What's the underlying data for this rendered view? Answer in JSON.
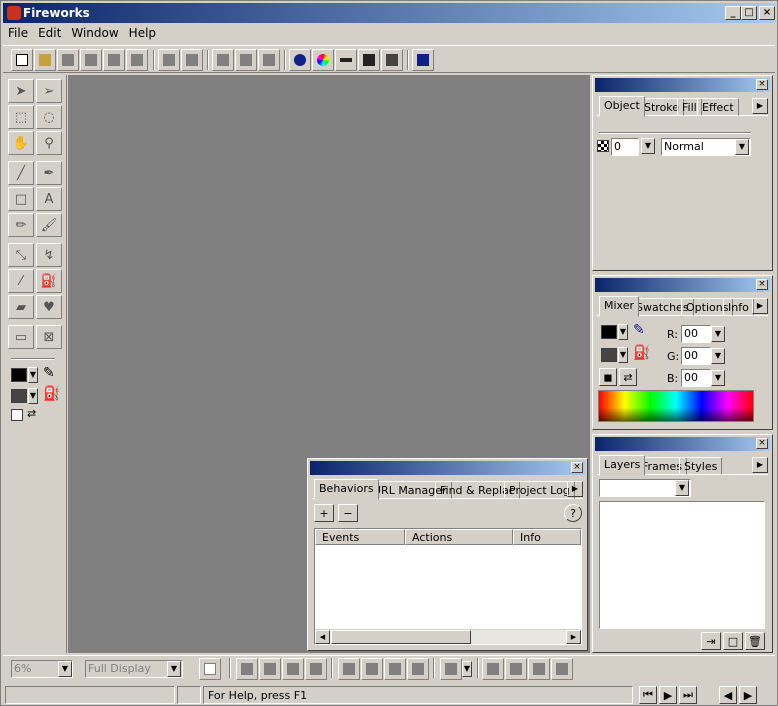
{
  "app": {
    "title": "Fireworks"
  },
  "window_controls": {
    "minimize": "_",
    "maximize": "□",
    "close": "×"
  },
  "menu": [
    "File",
    "Edit",
    "Window",
    "Help"
  ],
  "toolbar": {
    "icons": [
      "new-icon",
      "open-icon",
      "save-icon",
      "import-icon",
      "export-icon",
      "print-icon",
      "undo-icon",
      "redo-icon",
      "cut-icon",
      "copy-icon",
      "paste-icon",
      "info-icon",
      "color-mixer-icon",
      "stroke-icon",
      "swatches-icon",
      "layers-icon",
      "help-icon"
    ]
  },
  "object_panel": {
    "tabs": [
      "Object",
      "Stroke",
      "Fill",
      "Effect"
    ],
    "opacity_value": "0",
    "blend_mode": "Normal"
  },
  "mixer_panel": {
    "tabs": [
      "Mixer",
      "Swatches",
      "Options",
      "Info"
    ],
    "labels": {
      "r": "R:",
      "g": "G:",
      "b": "B:"
    },
    "values": {
      "r": "00",
      "g": "00",
      "b": "00"
    }
  },
  "layers_panel": {
    "tabs": [
      "Layers",
      "Frames",
      "Styles"
    ],
    "dropdown_value": ""
  },
  "behaviors_panel": {
    "tabs": [
      "Behaviors",
      "URL Manager",
      "Find & Replac",
      "Project Log"
    ],
    "add_label": "+",
    "remove_label": "−",
    "help_label": "?",
    "columns": [
      "Events",
      "Actions",
      "Info"
    ]
  },
  "bottombar": {
    "zoom": "6%",
    "display_mode": "Full Display"
  },
  "status": {
    "help_text": "For Help, press F1"
  }
}
